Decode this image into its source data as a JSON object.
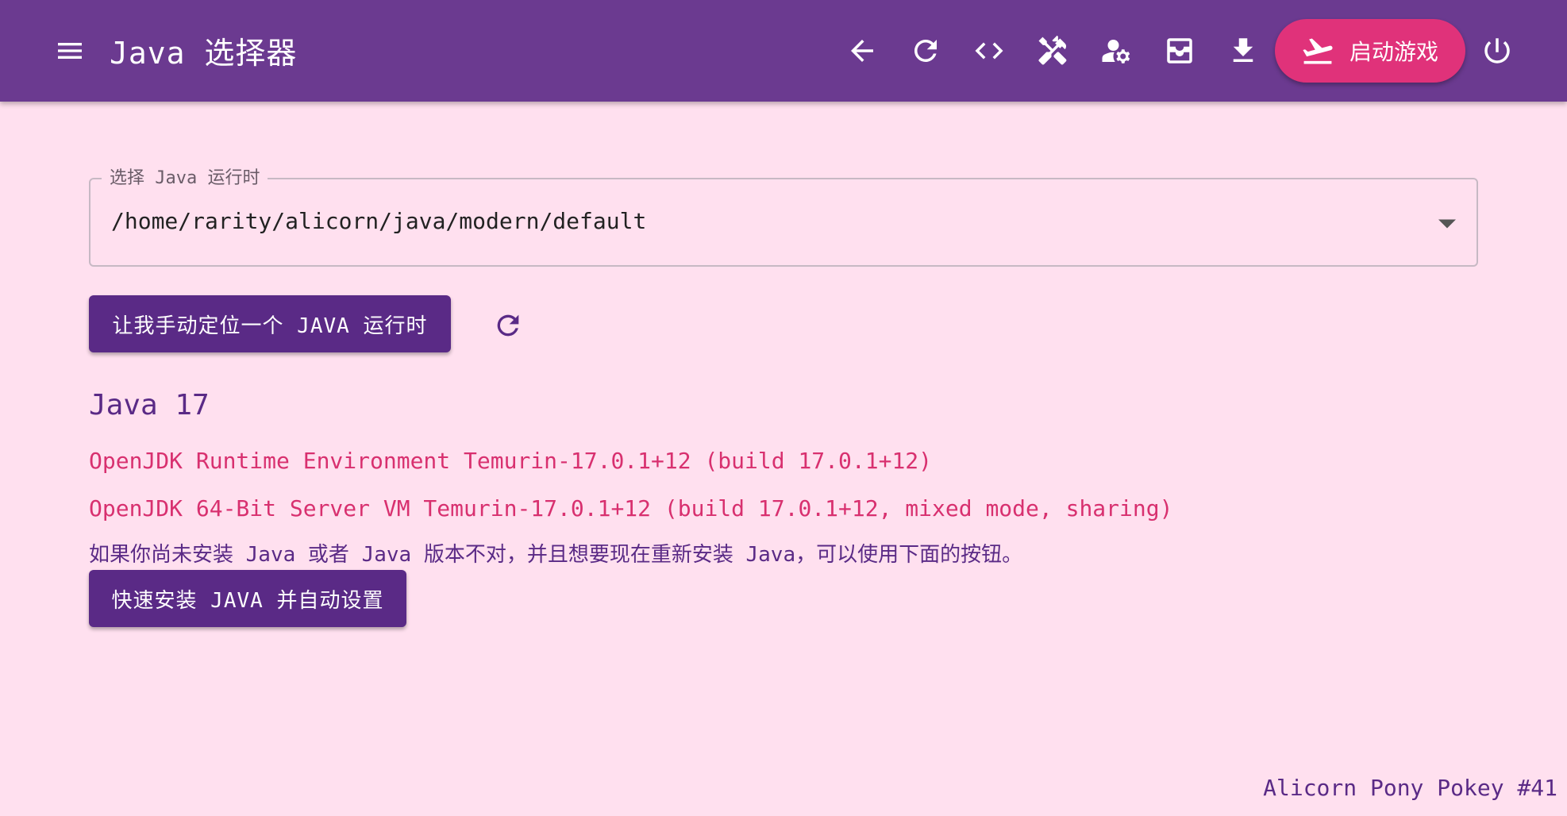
{
  "appbar": {
    "title": "Java 选择器",
    "launch_label": "启动游戏",
    "icons": [
      "menu-icon",
      "arrow-back-icon",
      "refresh-icon",
      "code-icon",
      "tools-icon",
      "user-settings-icon",
      "inbox-icon",
      "download-icon",
      "flight-takeoff-icon",
      "power-icon"
    ]
  },
  "java_select": {
    "legend": "选择 Java 运行时",
    "value": "/home/rarity/alicorn/java/modern/default"
  },
  "buttons": {
    "manual_locate": "让我手动定位一个 JAVA 运行时",
    "quick_install": "快速安装 JAVA 并自动设置"
  },
  "java_info": {
    "heading": "Java 17",
    "runtime_line": "OpenJDK Runtime Environment Temurin-17.0.1+12 (build 17.0.1+12)",
    "vm_line": "OpenJDK 64-Bit Server VM Temurin-17.0.1+12 (build 17.0.1+12, mixed mode, sharing)",
    "hint": "如果你尚未安装 Java 或者 Java 版本不对，并且想要现在重新安装 Java，可以使用下面的按钮。"
  },
  "footer": {
    "version": "Alicorn Pony Pokey #41"
  },
  "colors": {
    "appbar": "#6b3a90",
    "background": "#ffe0ef",
    "launch": "#e0327a",
    "primary": "#5a2a86",
    "accent_text": "#d8306f"
  }
}
